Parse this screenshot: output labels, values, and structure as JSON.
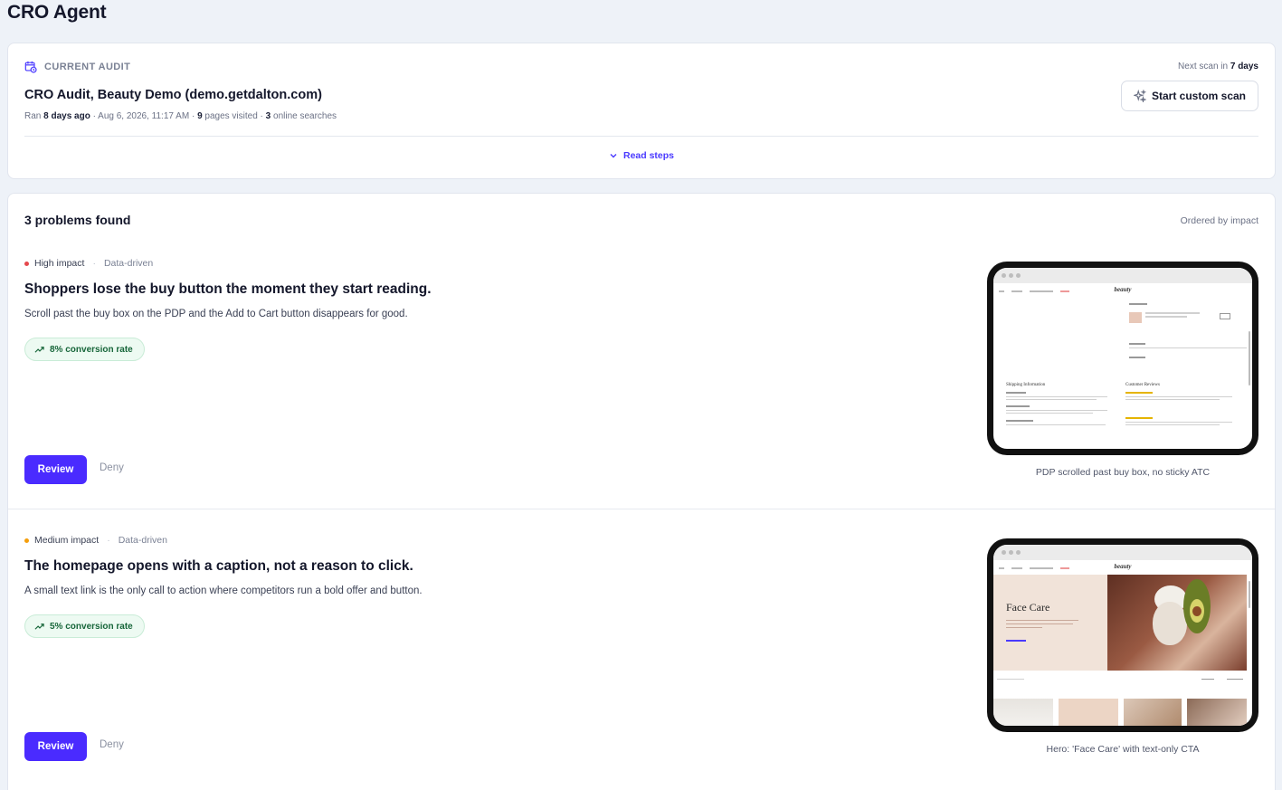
{
  "app": {
    "title": "CRO Agent"
  },
  "audit": {
    "label": "CURRENT AUDIT",
    "title": "CRO Audit, Beauty Demo (demo.getdalton.com)",
    "meta": {
      "ran_prefix": "Ran ",
      "ran_ago": "8 days ago",
      "date": " · Aug 6, 2026, 11:17 AM · ",
      "pages_count": "9",
      "pages_label": " pages visited · ",
      "searches_count": "3",
      "searches_label": " online searches"
    },
    "next_scan_prefix": "Next scan in ",
    "next_scan_value": "7 days",
    "custom_scan_label": "Start custom scan",
    "read_steps_label": "Read steps"
  },
  "problems": {
    "count_label": "3 problems found",
    "ordered_label": "Ordered by impact",
    "items": [
      {
        "impact": "High impact",
        "tag": "Data-driven",
        "title": "Shoppers lose the buy button the moment they start reading.",
        "description": "Scroll past the buy box on the PDP and the Add to Cart button disappears for good.",
        "metric": "8% conversion rate",
        "review_label": "Review",
        "deny_label": "Deny",
        "caption": "PDP scrolled past buy box, no sticky ATC",
        "impact_color": "#e5484d"
      },
      {
        "impact": "Medium impact",
        "tag": "Data-driven",
        "title": "The homepage opens with a caption, not a reason to click.",
        "description": "A small text link is the only call to action where competitors run a bold offer and button.",
        "metric": "5% conversion rate",
        "review_label": "Review",
        "deny_label": "Deny",
        "caption": "Hero: 'Face Care' with text-only CTA",
        "impact_color": "#f59e0b"
      }
    ]
  },
  "screenshots": {
    "brand": "beauty",
    "hero_heading": "Face Care",
    "shipping_heading": "Shipping Information",
    "reviews_heading": "Customer Reviews"
  },
  "colors": {
    "accent": "#4a2bff",
    "link": "#4a3aff",
    "success_bg": "#edfaf2",
    "success_text": "#17663a",
    "page_bg": "#eef2f8"
  }
}
